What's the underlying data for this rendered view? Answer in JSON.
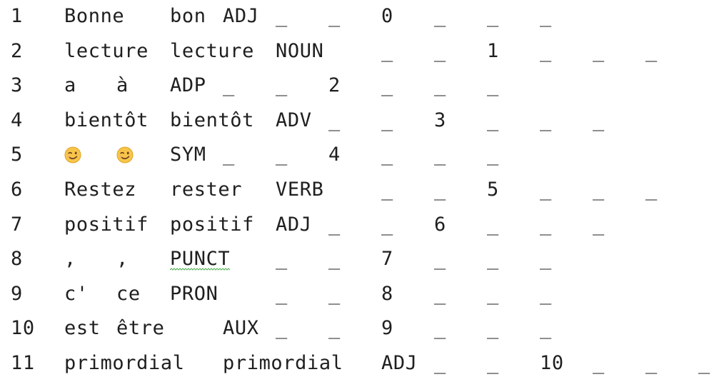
{
  "lines": [
    {
      "tokens": [
        "1",
        "Bonne",
        "bon",
        "ADJ",
        "_",
        "_",
        "0",
        "_",
        "_",
        "_"
      ]
    },
    {
      "tokens": [
        "2",
        "lecture",
        "lecture",
        "NOUN",
        "_",
        "_",
        "1",
        "_",
        "_",
        "_"
      ]
    },
    {
      "tokens": [
        "3",
        "a",
        "à",
        "ADP",
        "_",
        "_",
        "2",
        "_",
        "_",
        "_"
      ]
    },
    {
      "tokens": [
        "4",
        "bientôt",
        "bientôt",
        "ADV",
        "_",
        "_",
        "3",
        "_",
        "_",
        "_"
      ]
    },
    {
      "tokens": [
        "5",
        "😉",
        "😉",
        "SYM",
        "_",
        "_",
        "4",
        "_",
        "_",
        "_"
      ]
    },
    {
      "tokens": [
        "6",
        "Restez",
        "rester",
        "VERB",
        "_",
        "_",
        "5",
        "_",
        "_",
        "_"
      ]
    },
    {
      "tokens": [
        "7",
        "positif",
        "positif",
        "ADJ",
        "_",
        "_",
        "6",
        "_",
        "_",
        "_"
      ]
    },
    {
      "tokens": [
        "8",
        ",",
        ",",
        "PUNCT",
        "_",
        "_",
        "7",
        "_",
        "_",
        "_"
      ]
    },
    {
      "tokens": [
        "9",
        "c'",
        "ce",
        "PRON",
        "_",
        "_",
        "8",
        "_",
        "_",
        "_"
      ]
    },
    {
      "tokens": [
        "10",
        "est",
        "être",
        "AUX",
        "_",
        "_",
        "9",
        "_",
        "_",
        "_"
      ]
    },
    {
      "tokens": [
        "11",
        "primordial",
        "primordial",
        "ADJ",
        "_",
        "_",
        "10",
        "_",
        "_",
        "_"
      ]
    }
  ],
  "colors": {
    "text": "#1f1f1f",
    "background": "#ffffff",
    "spellcheck_underline": "#4caf50"
  }
}
